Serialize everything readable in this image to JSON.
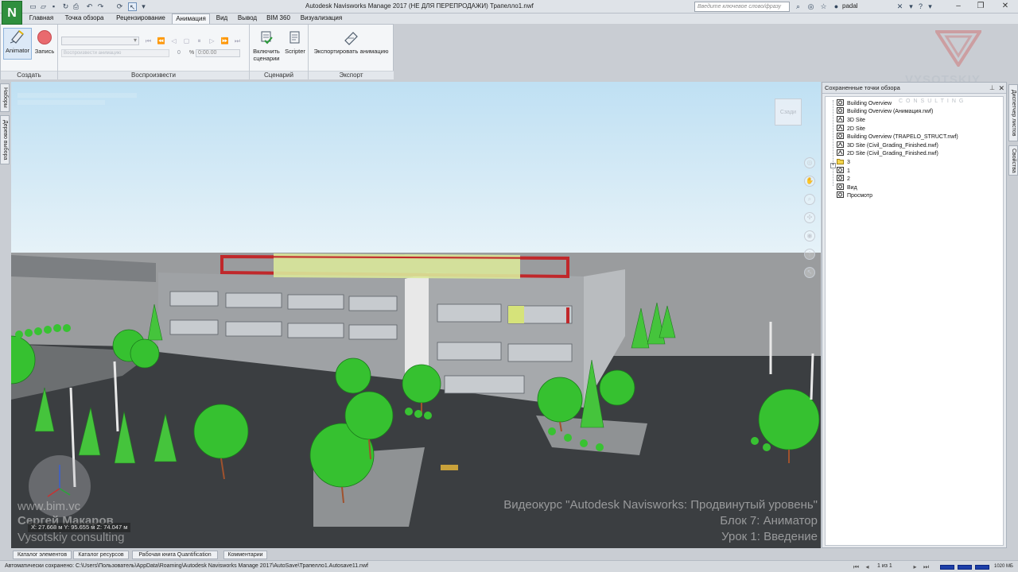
{
  "window": {
    "title": "Autodesk Navisworks Manage 2017 (НЕ ДЛЯ ПЕРЕПРОДАЖИ)    Трапелло1.nwf",
    "logo_letter": "N",
    "search_placeholder": "Введите ключевое слово/фразу",
    "user": "padal"
  },
  "menu_tabs": [
    "Главная",
    "Точка обзора",
    "Рецензирование",
    "Анимация",
    "Вид",
    "Вывод",
    "BIM 360",
    "Визуализация"
  ],
  "active_tab": "Анимация",
  "ribbon": {
    "groups": {
      "create": "Создать",
      "playback": "Воспроизвести",
      "script": "Сценарий",
      "export": "Экспорт"
    },
    "buttons": {
      "animator": "Animator",
      "record": "Запись",
      "enable_scripts_line1": "Включить",
      "enable_scripts_line2": "сценарии",
      "scripter": "Scripter",
      "export_animation": "Экспортировать анимацию"
    },
    "playback": {
      "position": "0",
      "percent_sign": "%",
      "time": "0:00.00",
      "slider_text": "Воспроизвести анимацию"
    }
  },
  "left_tabs": [
    "Наборы",
    "Дерево выбора"
  ],
  "right_tabs": [
    "Диспетчер листов",
    "Свойства"
  ],
  "viewport": {
    "viewcube_label": "Сзади",
    "coords": "X: 27.668 м  Y: 95.655 м  Z: 74.047 м",
    "watermark_left": [
      "www.bim.vc",
      "Сергей Макаров",
      "Vysotskiy consulting"
    ],
    "watermark_right": [
      "Видеокурс \"Autodesk Navisworks: Продвинутый уровень\"",
      "Блок 7: Аниматор",
      "Урок 1: Введение"
    ]
  },
  "brand": {
    "name": "VYSOTSKIY",
    "sub": "CONSULTING"
  },
  "saved_viewpoints": {
    "title": "Сохраненные точки обзора",
    "items": [
      "Building Overview",
      "Building Overview (Анимация.nwf)",
      "3D Site",
      "2D Site",
      "Building Overview (TRAPELO_STRUCT.nwf)",
      "3D Site (Civil_Grading_Finished.nwf)",
      "2D Site (Civil_Grading_Finished.nwf)",
      "3",
      "1",
      "2",
      "Вид",
      "Просмотр"
    ]
  },
  "bottom_tabs": [
    "Каталог элементов",
    "Каталог ресурсов",
    "Рабочая книга Quantification",
    "Комментарии"
  ],
  "status": {
    "autosave": "Автоматически сохранено: C:\\Users\\Пользователь\\AppData\\Roaming\\Autodesk Navisworks Manage 2017\\AutoSave\\Трапелло1.Autosave11.nwf",
    "page": "1 из 1",
    "memory": "1020 МБ"
  },
  "colors": {
    "sky": "#d8ebf7",
    "ground": "#3a3d40",
    "tree": "#3cc43a",
    "accent": "#2f8f3e"
  }
}
